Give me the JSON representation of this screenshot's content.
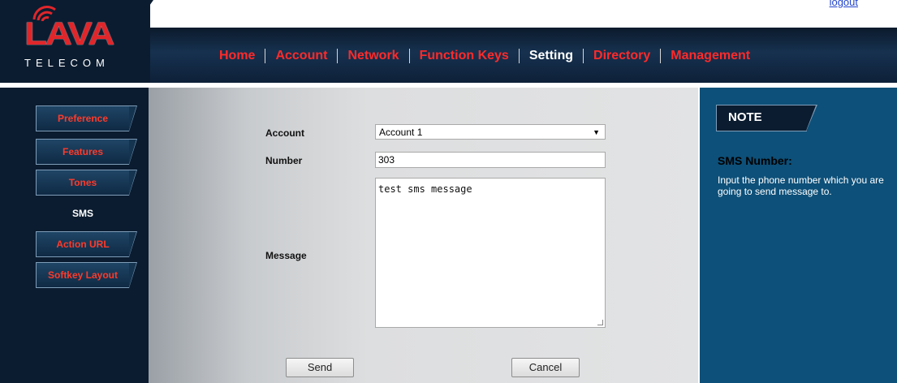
{
  "header": {
    "logout_label": "logout",
    "logo_text": "LAVA",
    "logo_subtext": "TELECOM",
    "nav": [
      "Home",
      "Account",
      "Network",
      "Function Keys",
      "Setting",
      "Directory",
      "Management"
    ],
    "active_nav": "Setting"
  },
  "sidebar": {
    "items": [
      {
        "label": "Preference"
      },
      {
        "label": "Features"
      },
      {
        "label": "Tones"
      },
      {
        "label": "SMS"
      },
      {
        "label": "Action URL"
      },
      {
        "label": "Softkey Layout"
      }
    ],
    "active": "SMS"
  },
  "form": {
    "account_label": "Account",
    "account_value": "Account 1",
    "number_label": "Number",
    "number_value": "303",
    "message_label": "Message",
    "message_value": "test sms message",
    "send_label": "Send",
    "cancel_label": "Cancel"
  },
  "note": {
    "tab_label": "NOTE",
    "title": "SMS Number:",
    "text": "Input the phone number which you are going to send message to."
  },
  "colors": {
    "accent_red": "#ff2a2a",
    "header_navy": "#0b1c30",
    "note_blue": "#0d5079"
  }
}
